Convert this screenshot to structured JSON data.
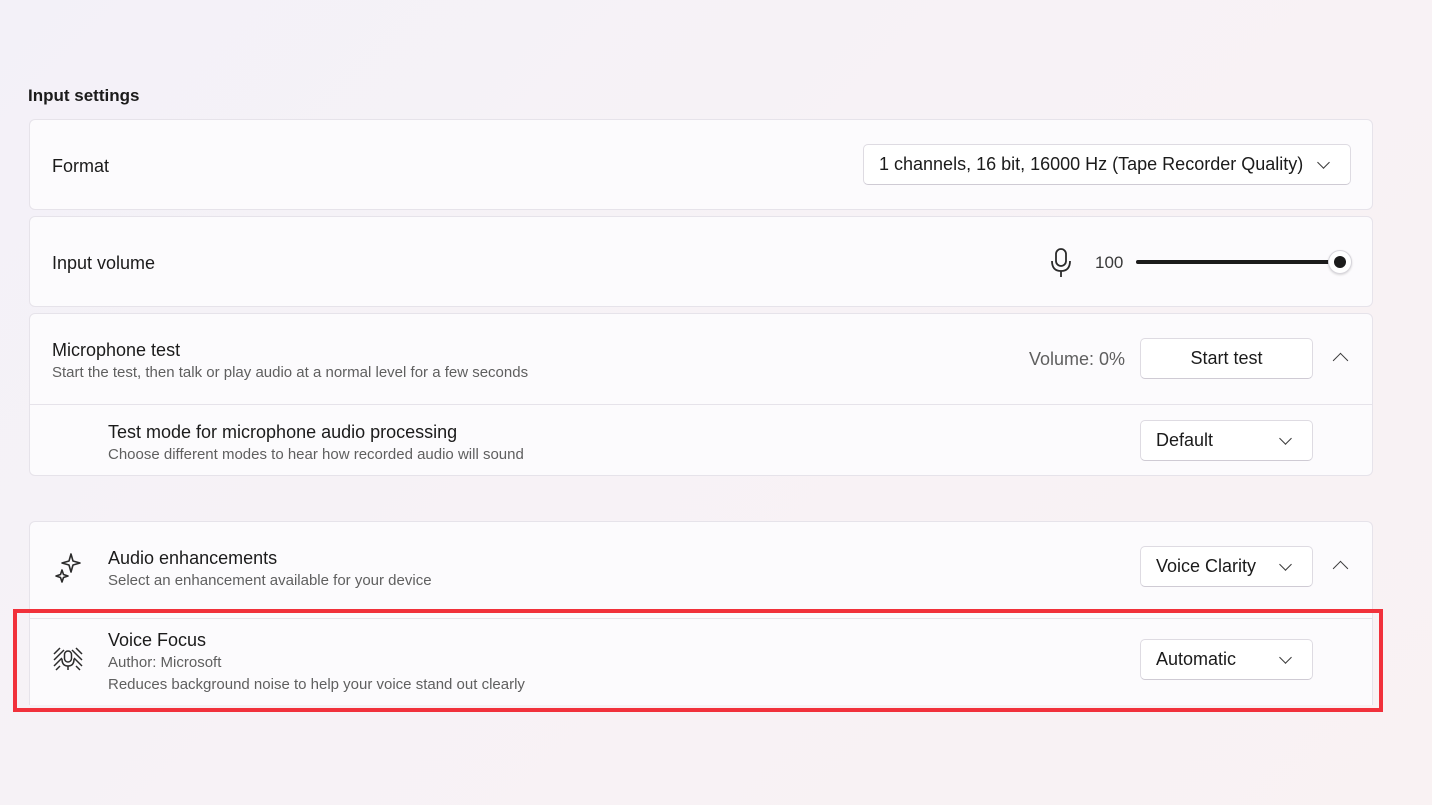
{
  "section": {
    "title": "Input settings"
  },
  "format": {
    "label": "Format",
    "selected": "1 channels, 16 bit, 16000 Hz (Tape Recorder Quality)"
  },
  "input_volume": {
    "label": "Input volume",
    "value_text": "100",
    "level": 1.0,
    "icon": "microphone-icon"
  },
  "mic_test": {
    "label": "Microphone test",
    "description": "Start the test, then talk or play audio at a normal level for a few seconds",
    "volume_text": "Volume: 0%",
    "button_label": "Start test",
    "test_mode": {
      "label": "Test mode for microphone audio processing",
      "description": "Choose different modes to hear how recorded audio will sound",
      "selected": "Default"
    }
  },
  "audio_enhancements": {
    "label": "Audio enhancements",
    "description": "Select an enhancement available for your device",
    "selected": "Voice Clarity",
    "icon": "sparkle-icon",
    "voice_focus": {
      "label": "Voice Focus",
      "author": "Author: Microsoft",
      "description": "Reduces background noise to help your voice stand out clearly",
      "selected": "Automatic",
      "icon": "voice-focus-icon"
    }
  },
  "colors": {
    "accent_slider": "#1b1b1b",
    "highlight": "#f1313b"
  }
}
